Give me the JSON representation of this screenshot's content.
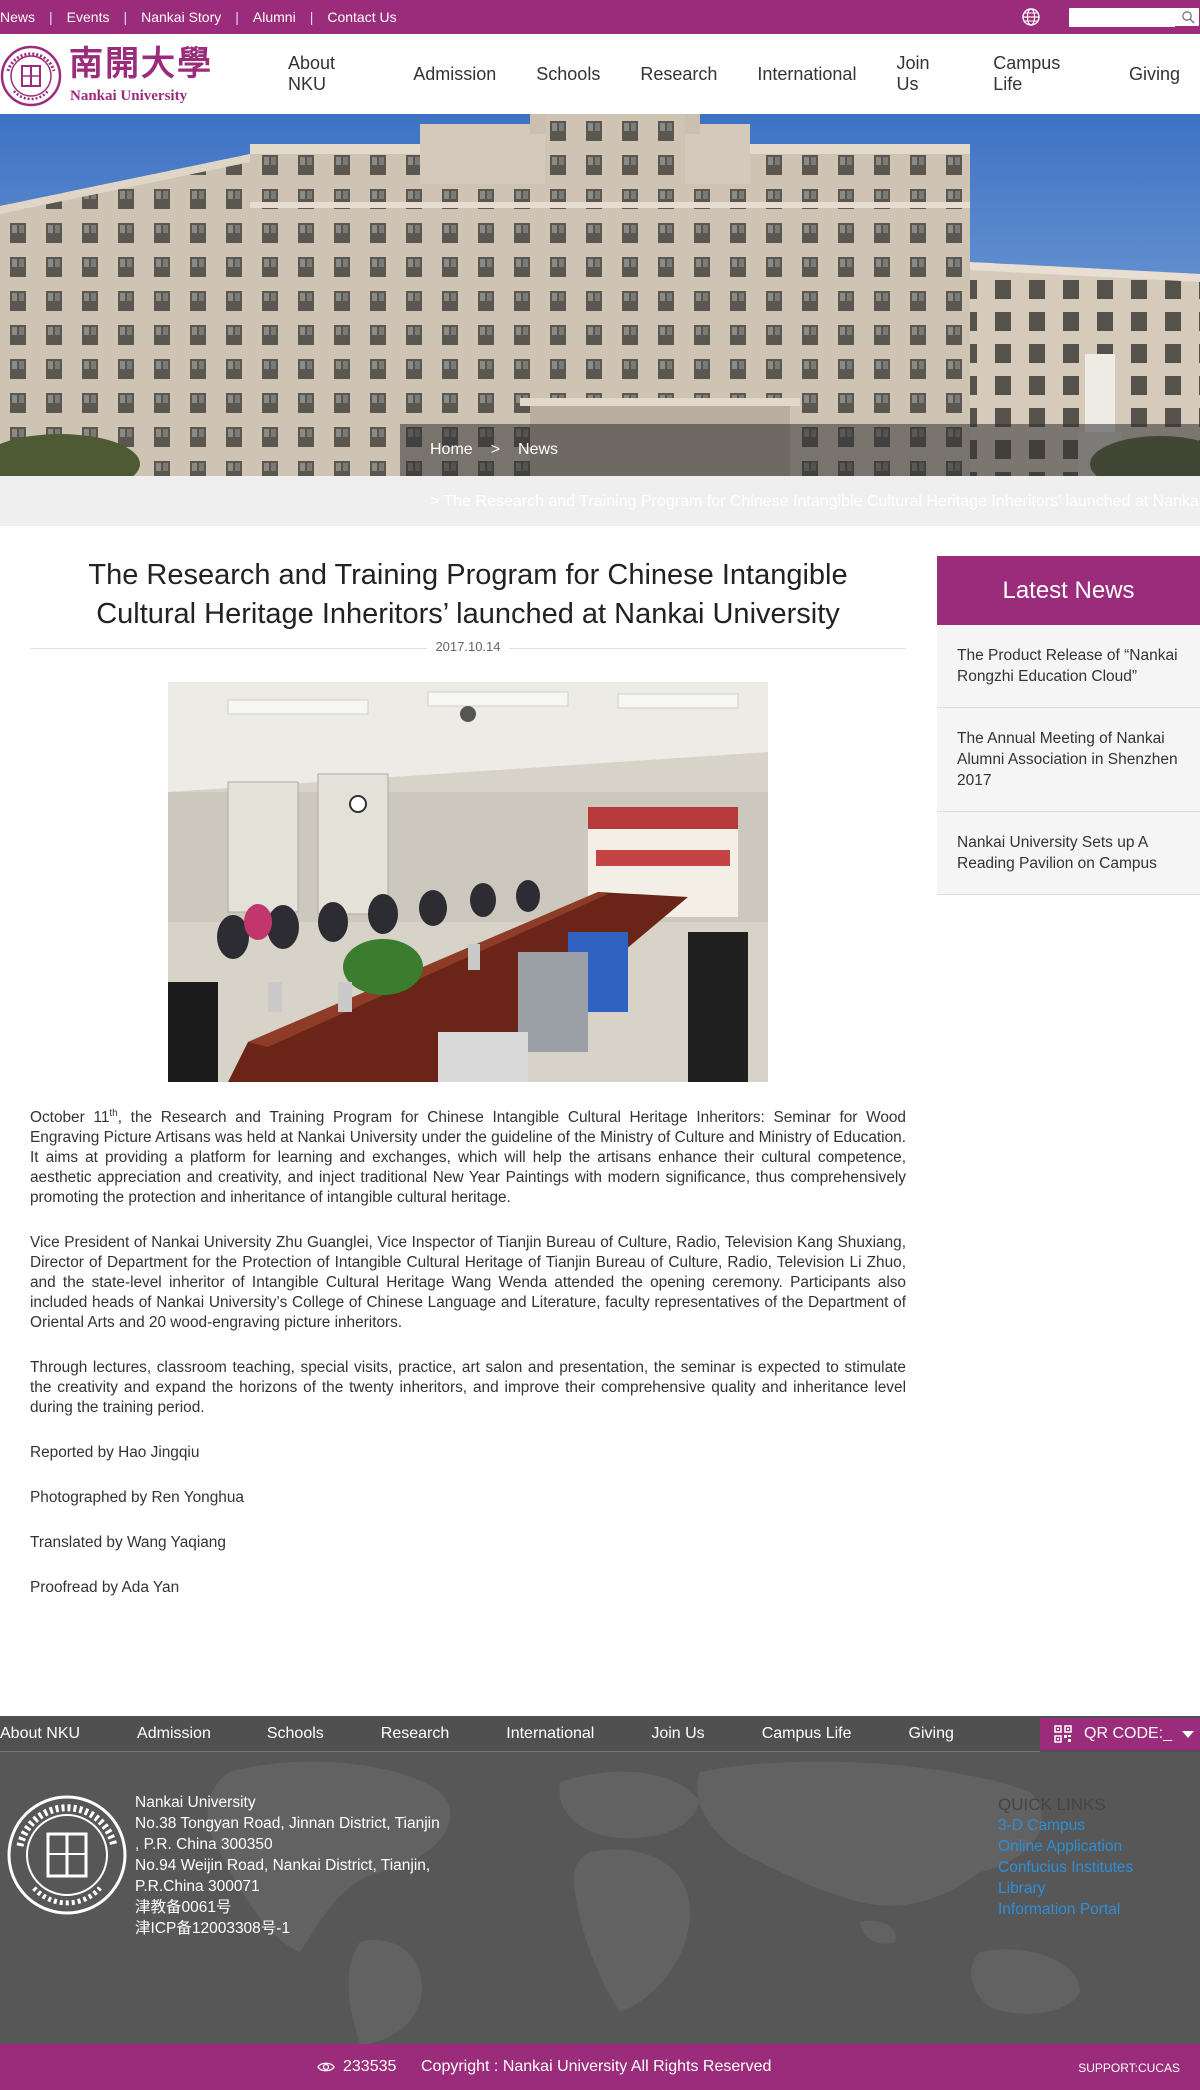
{
  "topbar": {
    "links": [
      "News",
      "Events",
      "Nankai Story",
      "Alumni",
      "Contact Us"
    ],
    "search_placeholder": ""
  },
  "header": {
    "logo_cn": "南開大學",
    "logo_en": "Nankai University",
    "nav": [
      "About NKU",
      "Admission",
      "Schools",
      "Research",
      "International",
      "Join Us",
      "Campus Life",
      "Giving"
    ]
  },
  "breadcrumb": {
    "home": "Home",
    "separator": ">",
    "section": "News"
  },
  "titlebar_text": ">     The Research and Training Program for Chinese Intangible Cultural Heritage Inheritors’ launched at Nankai University",
  "article": {
    "title": "The Research and Training Program for Chinese Intangible Cultural Heritage Inheritors’ launched at Nankai University",
    "date": "2017.10.14",
    "p1_pre": "October 11",
    "p1_sup": "th",
    "p1_post": ", the Research and Training Program for Chinese Intangible Cultural Heritage Inheritors: Seminar for Wood Engraving Picture Artisans was held at Nankai University under the guideline of the Ministry of Culture and Ministry of Education. It aims at providing a platform for learning and exchanges, which will help the artisans enhance their cultural competence, aesthetic appreciation and creativity, and inject traditional New Year Paintings with modern significance, thus comprehensively promoting the protection and inheritance of intangible cultural heritage.",
    "p2": "Vice President of Nankai University Zhu Guanglei, Vice Inspector of Tianjin Bureau of Culture, Radio, Television Kang Shuxiang, Director of Department for the Protection of Intangible Cultural Heritage of Tianjin Bureau of Culture, Radio, Television Li Zhuo, and the state-level inheritor of Intangible Cultural Heritage Wang Wenda attended the opening ceremony. Participants also included heads of Nankai University’s College of Chinese Language and Literature, faculty representatives of the Department of Oriental Arts and 20 wood-engraving picture inheritors.",
    "p3": "Through lectures, classroom teaching, special visits, practice, art salon and presentation, the seminar is expected to stimulate the creativity and expand the horizons of the twenty inheritors, and improve their comprehensive quality and inheritance level during the training period.",
    "reported": "Reported by Hao Jingqiu",
    "photographed": "Photographed by Ren Yonghua",
    "translated": "Translated by Wang Yaqiang",
    "proofread": "Proofread by Ada Yan"
  },
  "sidebar": {
    "heading": "Latest News",
    "items": [
      "The Product Release of “Nankai Rongzhi Education Cloud”",
      "The Annual Meeting of Nankai Alumni Association in Shenzhen 2017",
      "Nankai University Sets up A Reading Pavilion on Campus"
    ]
  },
  "footer": {
    "nav": [
      "About NKU",
      "Admission",
      "Schools",
      "Research",
      "International",
      "Join Us",
      "Campus Life",
      "Giving"
    ],
    "qr_label": "QR CODE:_",
    "address": [
      "Nankai University",
      "No.38 Tongyan Road, Jinnan District, Tianjin",
      ", P.R. China 300350",
      "No.94 Weijin Road,  Nankai District, Tianjin,",
      "P.R.China  300071",
      "津教备0061号",
      "津ICP备12003308号-1"
    ],
    "quick_links_title": "QUICK LINKS",
    "quick_links": [
      "3-D Campus",
      "Online Application",
      "Confucius Institutes",
      "Library",
      "Information Portal"
    ],
    "visits": "233535",
    "copyright": "Copyright : Nankai University All Rights Reserved",
    "support": "SUPPORT:CUCAS"
  },
  "colors": {
    "brand": "#9b2c7b",
    "footer_bg": "#575757",
    "link_blue": "#2f8ed6"
  },
  "icons": [
    "globe-icon",
    "search-icon",
    "qr-code-icon",
    "eye-icon"
  ]
}
